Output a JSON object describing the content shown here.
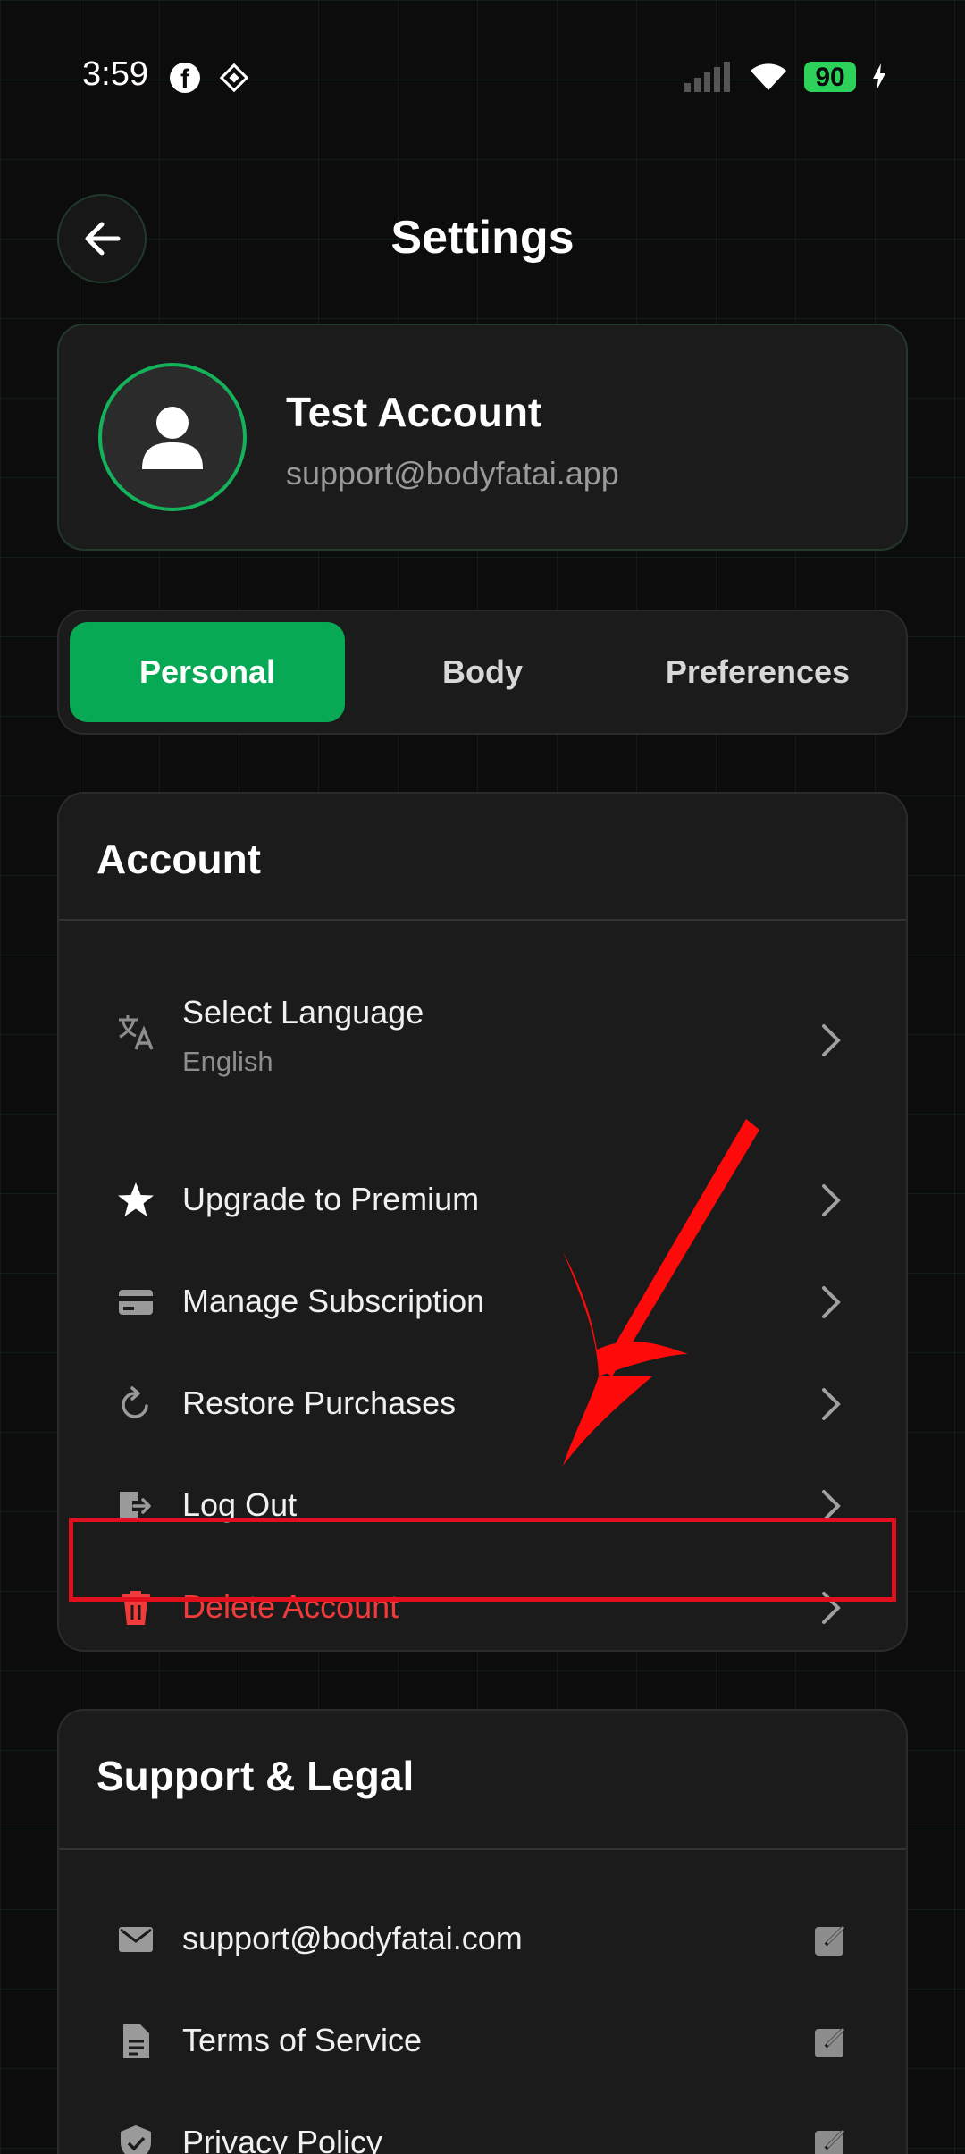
{
  "status_bar": {
    "time": "3:59",
    "battery": "90",
    "icons": [
      "facebook-icon",
      "diamond-app-icon",
      "signal-icon",
      "wifi-icon",
      "battery-icon",
      "charging-icon"
    ]
  },
  "header": {
    "title": "Settings",
    "back_icon": "arrow-left-icon"
  },
  "profile": {
    "name": "Test Account",
    "email": "support@bodyfatai.app"
  },
  "tabs": [
    {
      "label": "Personal",
      "active": true
    },
    {
      "label": "Body",
      "active": false
    },
    {
      "label": "Preferences",
      "active": false
    }
  ],
  "account": {
    "title": "Account",
    "items": [
      {
        "label": "Select Language",
        "sub": "English",
        "icon": "translate-icon"
      },
      {
        "label": "Upgrade to Premium",
        "icon": "star-icon"
      },
      {
        "label": "Manage Subscription",
        "icon": "credit-card-icon"
      },
      {
        "label": "Restore Purchases",
        "icon": "refresh-icon"
      },
      {
        "label": "Log Out",
        "icon": "logout-icon"
      },
      {
        "label": "Delete Account",
        "icon": "trash-icon"
      }
    ]
  },
  "support": {
    "title": "Support & Legal",
    "items": [
      {
        "label": "support@bodyfatai.com",
        "icon": "mail-icon"
      },
      {
        "label": "Terms of Service",
        "icon": "document-icon"
      },
      {
        "label": "Privacy Policy",
        "icon": "shield-icon"
      }
    ]
  },
  "colors": {
    "accent": "#08a955",
    "danger": "#ef3b3b",
    "annotation": "#e2101c",
    "background": "#0c0c0c",
    "card": "#1b1b1b"
  }
}
